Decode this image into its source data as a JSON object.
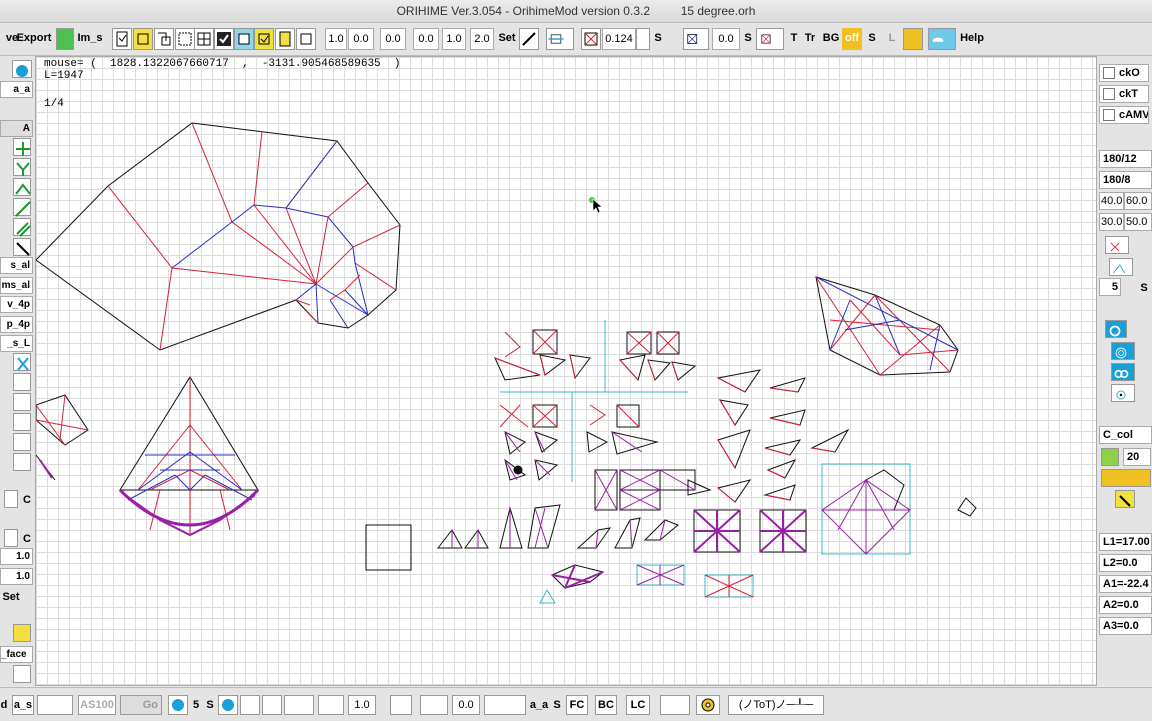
{
  "window": {
    "title": "ORIHIME Ver.3.054 - OrihimeMod version 0.3.2",
    "filename": "15 degree.orh"
  },
  "toolbar": {
    "save_label": "ve",
    "export_label": "Export",
    "im_s_label": "Im_s",
    "num1": "1.0",
    "num2": "0.0",
    "num3": "0.0",
    "num4": "0.0",
    "num5": "1.0",
    "num6": "2.0",
    "set_label": "Set",
    "num7": "0.124",
    "s_label": "S",
    "num8": "0.0",
    "s2_label": "S",
    "t_label": "T",
    "tr_label": "Tr",
    "bg_label": "BG",
    "off_label": "off",
    "s3_label": "S",
    "l_label": "L",
    "help_label": "Help"
  },
  "status": {
    "mouse_line": "mouse= (  1828.1322067660717  ,  -3131.905468589635  )",
    "length_line": "L=1947",
    "fraction": "1/4"
  },
  "left_panel": {
    "a_a": "a_a",
    "a_label": "A",
    "s_al": "s_al",
    "ms_al": "ms_al",
    "v_4p": "v_4p",
    "p_4p": "p_4p",
    "s_l": "_s_L",
    "c1": "C",
    "c2": "C",
    "v1": "1.0",
    "v2": "1.0",
    "set": "Set",
    "face": "_face"
  },
  "right_panel": {
    "cko": "ckO",
    "ckt": "ckT",
    "camv": "cAMV",
    "r1": "180/12",
    "r2": "180/8",
    "v1a": "40.0",
    "v1b": "60.0",
    "v2a": "30.0",
    "v2b": "50.0",
    "n5": "5",
    "s": "S",
    "c_col": "C_col",
    "c20": "20",
    "l1": "L1=17.00",
    "l2": "L2=0.0",
    "a1": "A1=-22.4",
    "a2": "A2=0.0",
    "a3": "A3=0.0"
  },
  "bottom_bar": {
    "d": "d",
    "a_s": "a_s",
    "as100": "AS100",
    "go": "Go",
    "five1": "5",
    "s1": "S",
    "v1": "1.0",
    "v2": "0.0",
    "a_a": "a_a",
    "s2": "S",
    "fc": "FC",
    "bc": "BC",
    "lc": "LC",
    "face_text": "(ノToT)ノ─┸─"
  },
  "colors": {
    "mountain": "#d8203a",
    "valley": "#2630c0",
    "edge": "#111111",
    "aux": "#38b8c8",
    "accent_yellow": "#f0e040",
    "icon_blue": "#1aa0d8"
  }
}
